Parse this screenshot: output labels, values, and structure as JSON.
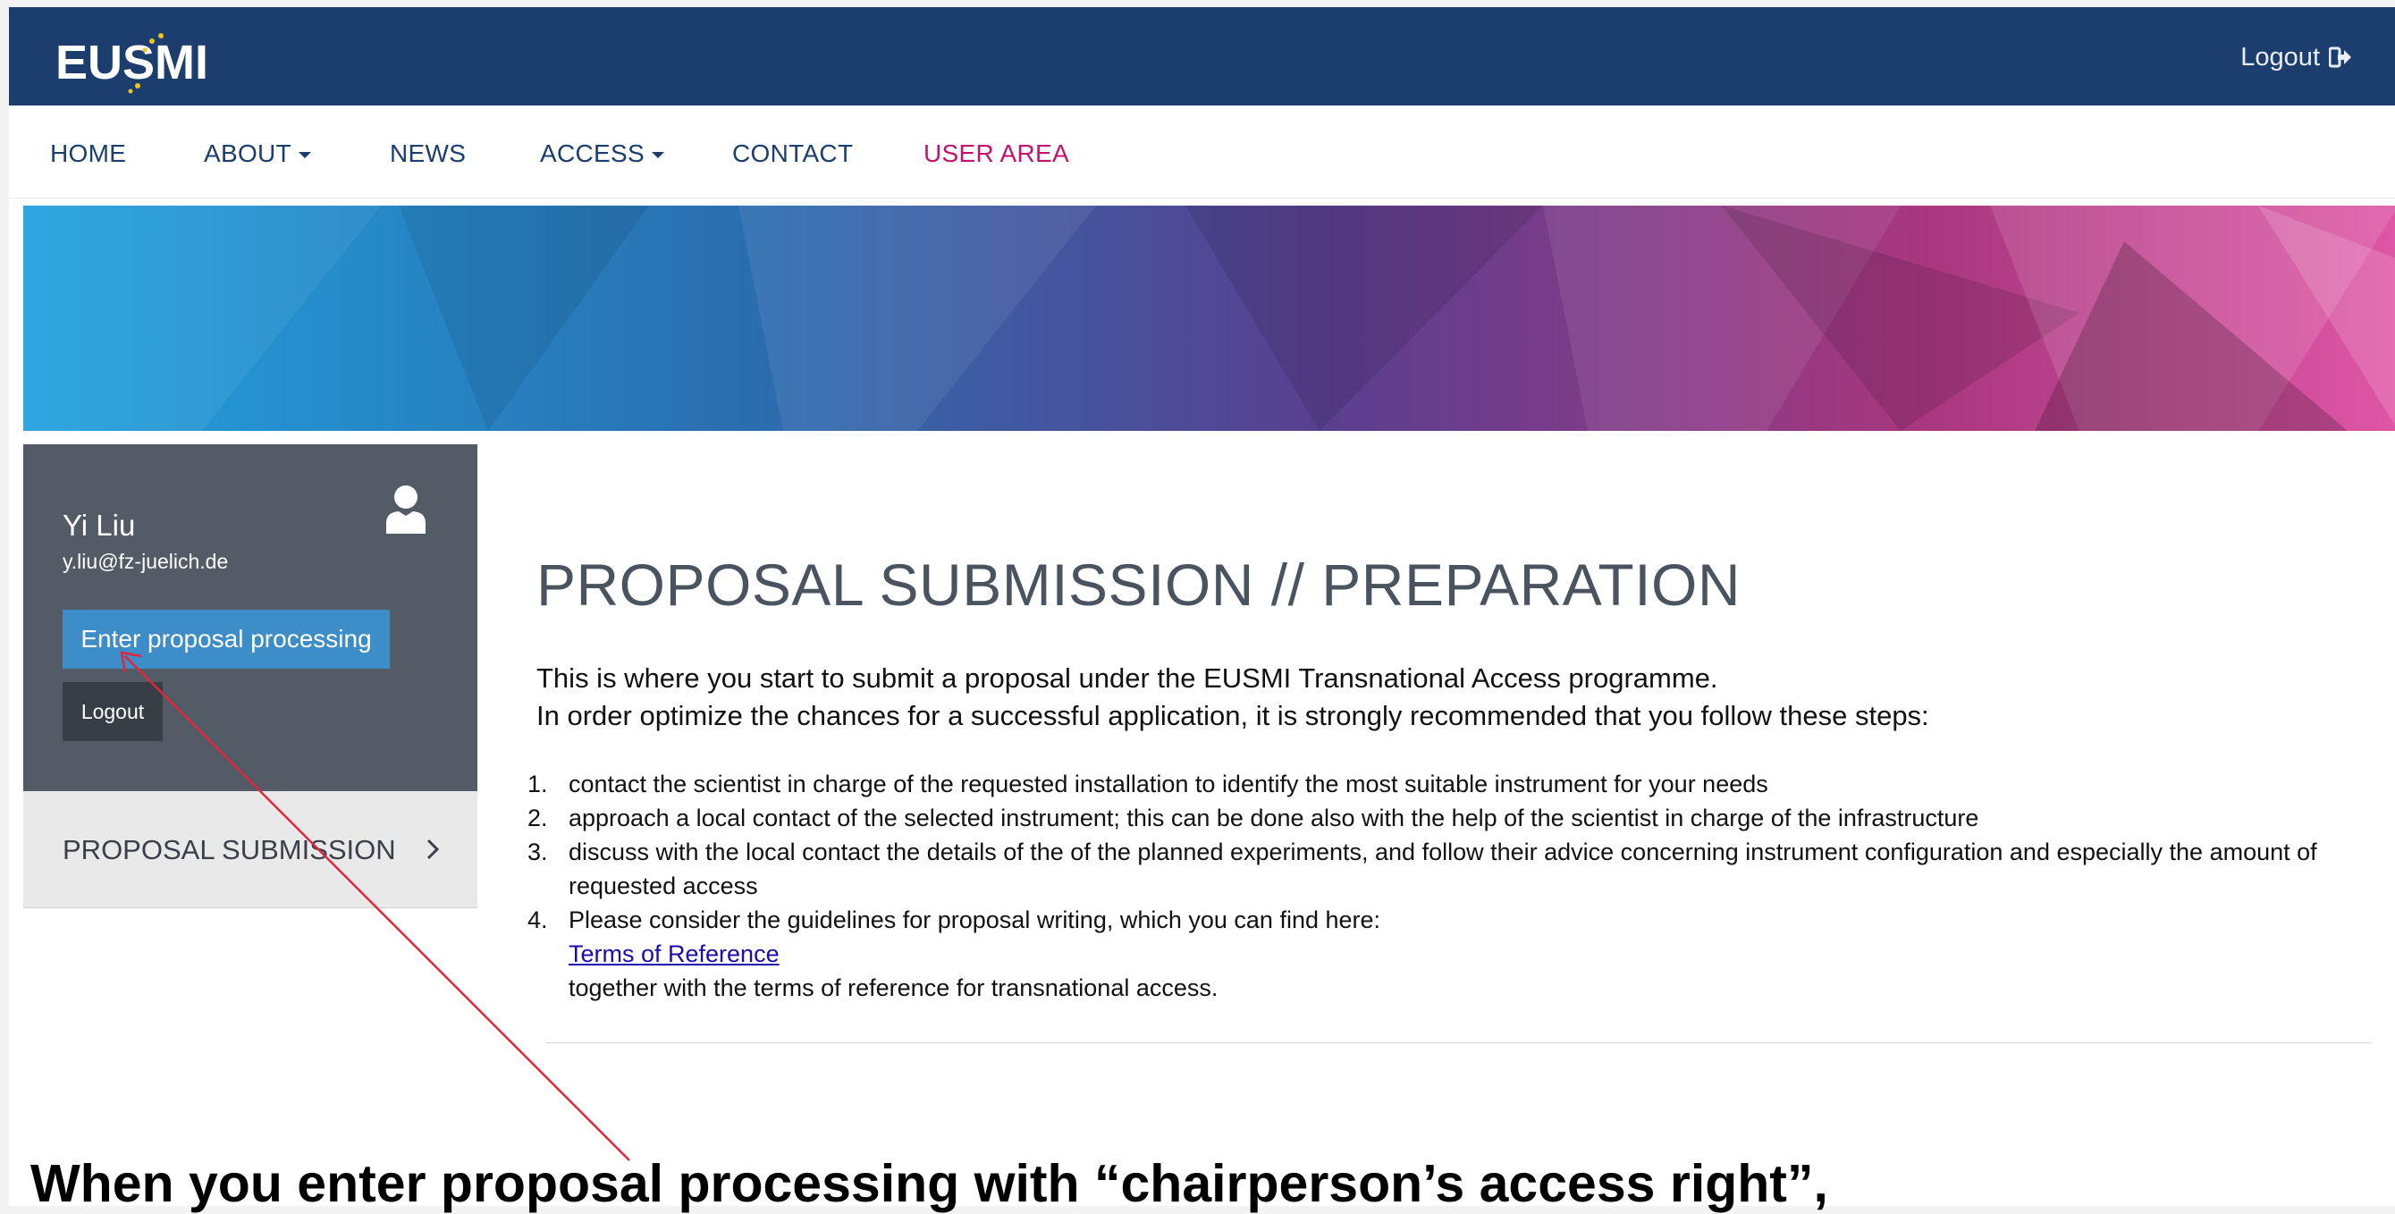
{
  "brand": {
    "logo_text": "EUSMI",
    "colors": {
      "header": "#1b3e6f",
      "nav_active": "#c4136f",
      "sidebar": "#535c66",
      "button": "#3d8dc8",
      "annotation_arrow": "#e0263c"
    }
  },
  "header": {
    "logout_label": "Logout",
    "logout_icon": "sign-out-icon"
  },
  "nav": {
    "items": [
      {
        "label": "HOME",
        "dropdown": false
      },
      {
        "label": "ABOUT",
        "dropdown": true
      },
      {
        "label": "NEWS",
        "dropdown": false
      },
      {
        "label": "ACCESS",
        "dropdown": true
      },
      {
        "label": "CONTACT",
        "dropdown": false
      },
      {
        "label": "USER AREA",
        "dropdown": false,
        "active": true
      }
    ]
  },
  "sidebar": {
    "user": {
      "name": "Yi Liu",
      "email": "y.liu@fz-juelich.de",
      "icon": "user-icon"
    },
    "enter_button": "Enter proposal processing",
    "logout_button": "Logout",
    "menu_item": "PROPOSAL SUBMISSION"
  },
  "main": {
    "title": "PROPOSAL SUBMISSION // PREPARATION",
    "intro_line1": "This is where you start to submit a proposal under the EUSMI Transnational Access programme.",
    "intro_line2": "In order optimize the chances for a successful application, it is strongly recommended that you follow these steps:",
    "steps": [
      {
        "num": "1.",
        "text": "contact the scientist in charge of the requested installation to identify the most suitable instrument for your needs"
      },
      {
        "num": "2.",
        "text": "approach a local contact of the selected instrument; this can be done also with the help of the scientist in charge of the infrastructure"
      },
      {
        "num": "3.",
        "text": "discuss with the local contact the details of the of the planned experiments, and follow their advice concerning instrument configuration and especially the amount of requested access"
      },
      {
        "num": "4.",
        "text": "Please consider the guidelines for proposal writing, which you can find here:",
        "link": "Terms of Reference",
        "after": "together with the terms of reference for transnational access."
      }
    ]
  },
  "annotation": {
    "text": "When you enter proposal processing with “chairperson’s access right”,"
  }
}
